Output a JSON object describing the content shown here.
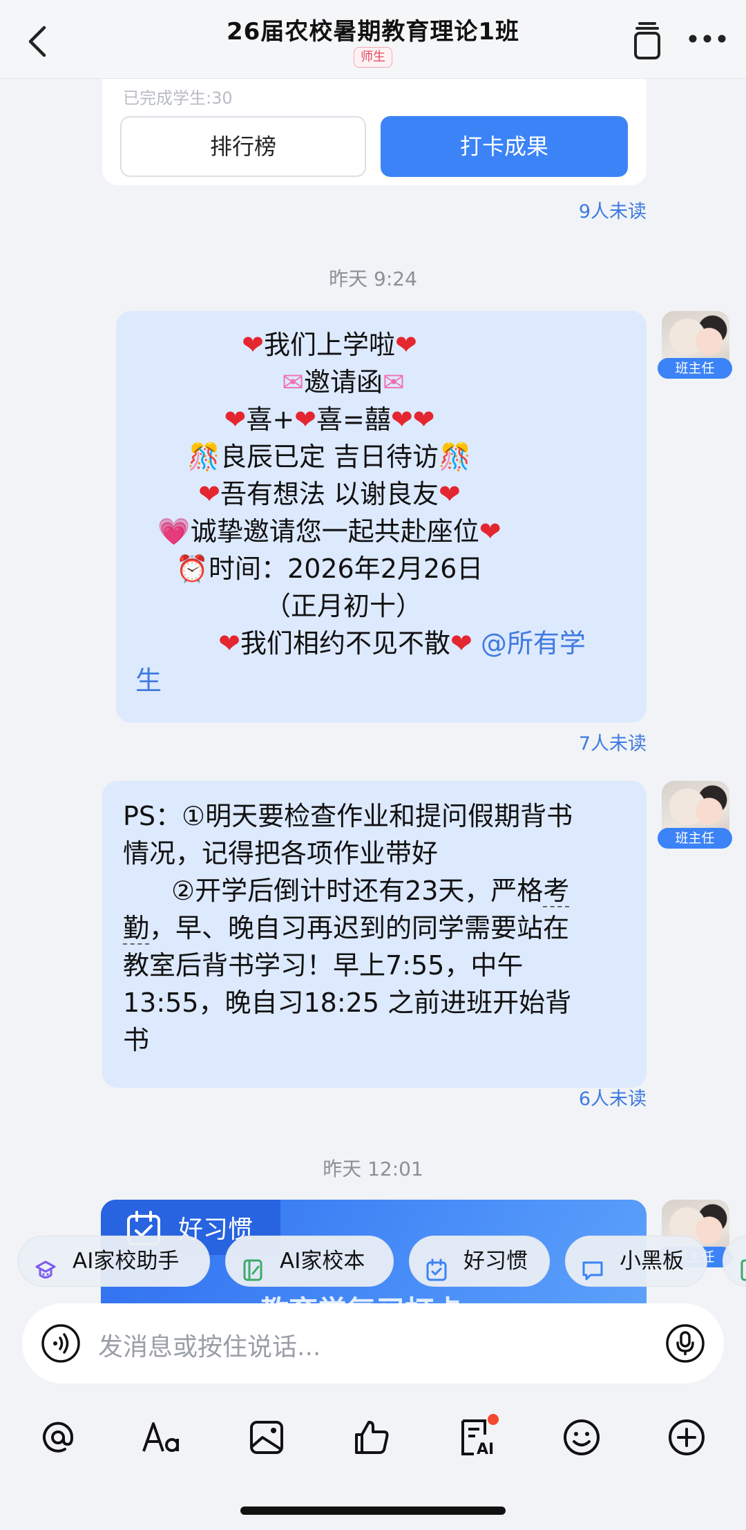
{
  "header": {
    "title": "26届农校暑期教育理论1班",
    "badge": "师生"
  },
  "top_card": {
    "faded_text": "已完成学生:30",
    "ranking_label": "排行榜",
    "result_label": "打卡成果",
    "read_status": "9人未读"
  },
  "messages": [
    {
      "timestamp": "昨天 9:24",
      "sender_tag": "班主任",
      "lines": [
        "我们上学啦",
        "邀请函",
        "喜+",
        "喜=囍",
        "良辰已定 吉日待访",
        "吾有想法 以谢良友",
        "诚挚邀请您一起共赴座位",
        "时间：2026年2月26日",
        "（正月初十）",
        "我们相约不见不散",
        "@所有学",
        "生"
      ],
      "read_status": "7人未读"
    },
    {
      "sender_tag": "班主任",
      "lines": [
        "PS：①明天要检查作业和提问假期背书",
        "情况，记得把各项作业带好",
        "②开学后倒计时还有23天，严格",
        "考",
        "勤",
        "，早、晚自习再迟到的同学需要站在",
        "教室后背书学习！早上7:55，中午",
        "13:55，晚自习18:25 之前进班开始背",
        "书"
      ],
      "read_status": "6人未读"
    },
    {
      "timestamp": "昨天 12:01",
      "sender_tag": "班主任",
      "card_title": "好习惯",
      "card_subtitle": "教育学复习打卡"
    }
  ],
  "chips": [
    {
      "label": "AI家校助手",
      "icon": "ai-assistant-icon"
    },
    {
      "label": "AI家校本",
      "icon": "notebook-icon"
    },
    {
      "label": "好习惯",
      "icon": "calendar-check-icon"
    },
    {
      "label": "小黑板",
      "icon": "board-icon"
    }
  ],
  "input": {
    "placeholder": "发消息或按住说话..."
  },
  "toolbar": [
    "at-icon",
    "font-icon",
    "image-icon",
    "thumbs-up-icon",
    "ai-doc-icon",
    "emoji-icon",
    "plus-icon"
  ],
  "colors": {
    "accent": "#3b83f6",
    "bubble": "#dde9fd",
    "mention": "#3f7ae0",
    "heart": "#e3262f"
  }
}
